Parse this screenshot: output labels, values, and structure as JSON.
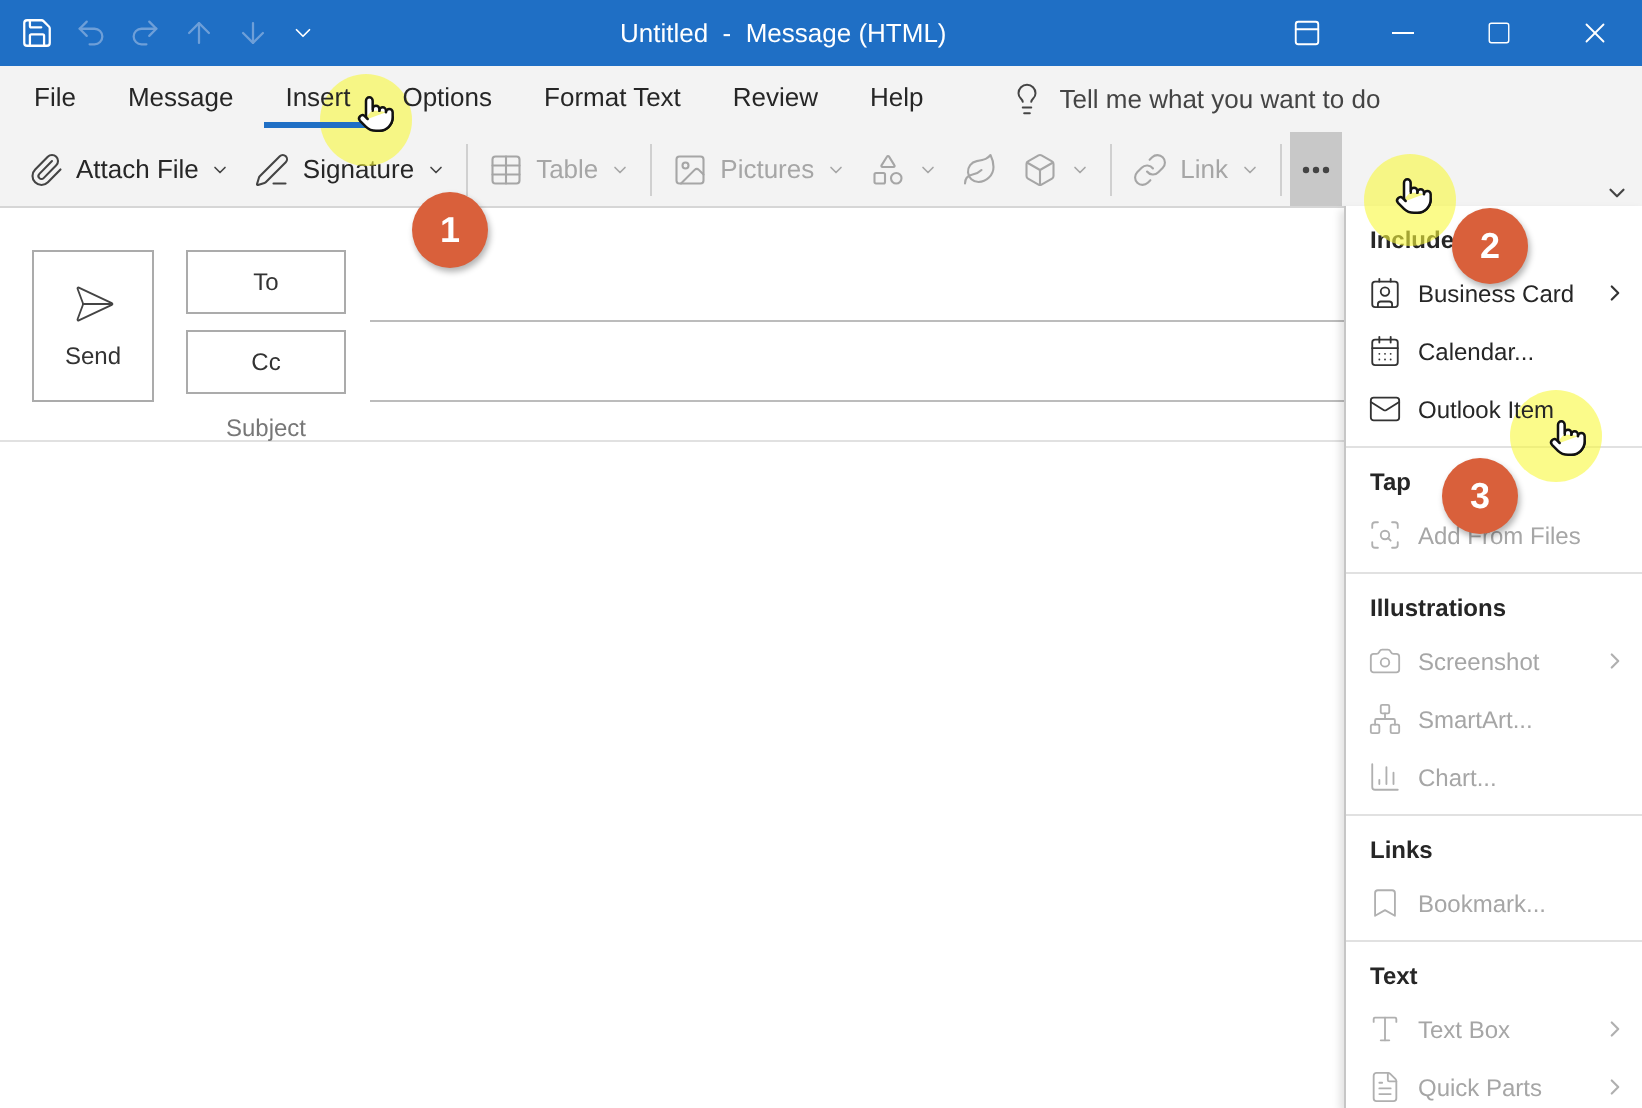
{
  "window": {
    "title": "Untitled  -  Message (HTML)"
  },
  "quick_access": [
    {
      "disabled": false
    },
    {
      "disabled": true
    },
    {
      "disabled": true
    },
    {
      "disabled": true
    },
    {
      "disabled": true
    },
    {
      "disabled": false
    }
  ],
  "tabs": [
    {
      "label": "File",
      "selected": false
    },
    {
      "label": "Message",
      "selected": false
    },
    {
      "label": "Insert",
      "selected": true
    },
    {
      "label": "Options",
      "selected": false
    },
    {
      "label": "Format Text",
      "selected": false
    },
    {
      "label": "Review",
      "selected": false
    },
    {
      "label": "Help",
      "selected": false
    }
  ],
  "tell_me": {
    "placeholder": "Tell me what you want to do"
  },
  "toolbar": [
    {
      "label": "Attach File",
      "disabled": false,
      "dropdown": true
    },
    {
      "label": "Signature",
      "disabled": false,
      "dropdown": true
    },
    {
      "label": "Table",
      "disabled": true,
      "dropdown": true
    },
    {
      "label": "Pictures",
      "disabled": true,
      "dropdown": true
    },
    {
      "disabled": true,
      "dropdown": true
    },
    {
      "disabled": true,
      "dropdown": false
    },
    {
      "disabled": true,
      "dropdown": true
    },
    {
      "label": "Link",
      "disabled": true,
      "dropdown": true
    },
    {
      "disabled": false,
      "dropdown": false,
      "selected": true
    }
  ],
  "compose": {
    "send": "Send",
    "to": "To",
    "cc": "Cc",
    "subject": "Subject"
  },
  "menu": [
    {
      "header": "Include",
      "items": [
        {
          "label": "Business Card",
          "disabled": false,
          "submenu": true
        },
        {
          "label": "Calendar...",
          "disabled": false,
          "submenu": false
        },
        {
          "label": "Outlook Item",
          "disabled": false,
          "submenu": false
        }
      ]
    },
    {
      "header": "Tap",
      "items": [
        {
          "label": "Add From Files",
          "disabled": true,
          "submenu": false
        }
      ]
    },
    {
      "header": "Illustrations",
      "items": [
        {
          "label": "Screenshot",
          "disabled": true,
          "submenu": true
        },
        {
          "label": "SmartArt...",
          "disabled": true,
          "submenu": false
        },
        {
          "label": "Chart...",
          "disabled": true,
          "submenu": false
        }
      ]
    },
    {
      "header": "Links",
      "items": [
        {
          "label": "Bookmark...",
          "disabled": true,
          "submenu": false
        }
      ]
    },
    {
      "header": "Text",
      "items": [
        {
          "label": "Text Box",
          "disabled": true,
          "submenu": true
        },
        {
          "label": "Quick Parts",
          "disabled": true,
          "submenu": true
        }
      ]
    }
  ],
  "steps": [
    {
      "number": "1"
    },
    {
      "number": "2"
    },
    {
      "number": "3"
    }
  ]
}
